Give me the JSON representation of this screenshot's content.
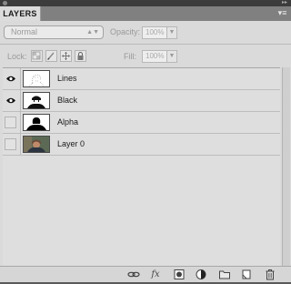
{
  "panel": {
    "tab_label": "LAYERS",
    "menu_icon": "panel-menu-icon"
  },
  "blend_mode": {
    "selected": "Normal"
  },
  "opacity": {
    "label": "Opacity:",
    "value": "100%"
  },
  "lock": {
    "label": "Lock:",
    "icons": [
      "lock-transparent-icon",
      "lock-image-icon",
      "lock-position-icon",
      "lock-all-icon"
    ]
  },
  "fill": {
    "label": "Fill:",
    "value": "100%"
  },
  "layers": [
    {
      "name": "Lines",
      "visible": true
    },
    {
      "name": "Black",
      "visible": true
    },
    {
      "name": "Alpha",
      "visible": false
    },
    {
      "name": "Layer 0",
      "visible": false
    }
  ],
  "footer_icons": [
    "link-layers-icon",
    "fx-icon",
    "add-mask-icon",
    "adjustment-layer-icon",
    "new-group-icon",
    "new-layer-icon",
    "trash-icon"
  ],
  "colors": {
    "panel_bg": "#dadada",
    "tab_bg": "#dcdcdc",
    "tab_strip": "#808080",
    "title_bar": "#3c3c3c"
  }
}
